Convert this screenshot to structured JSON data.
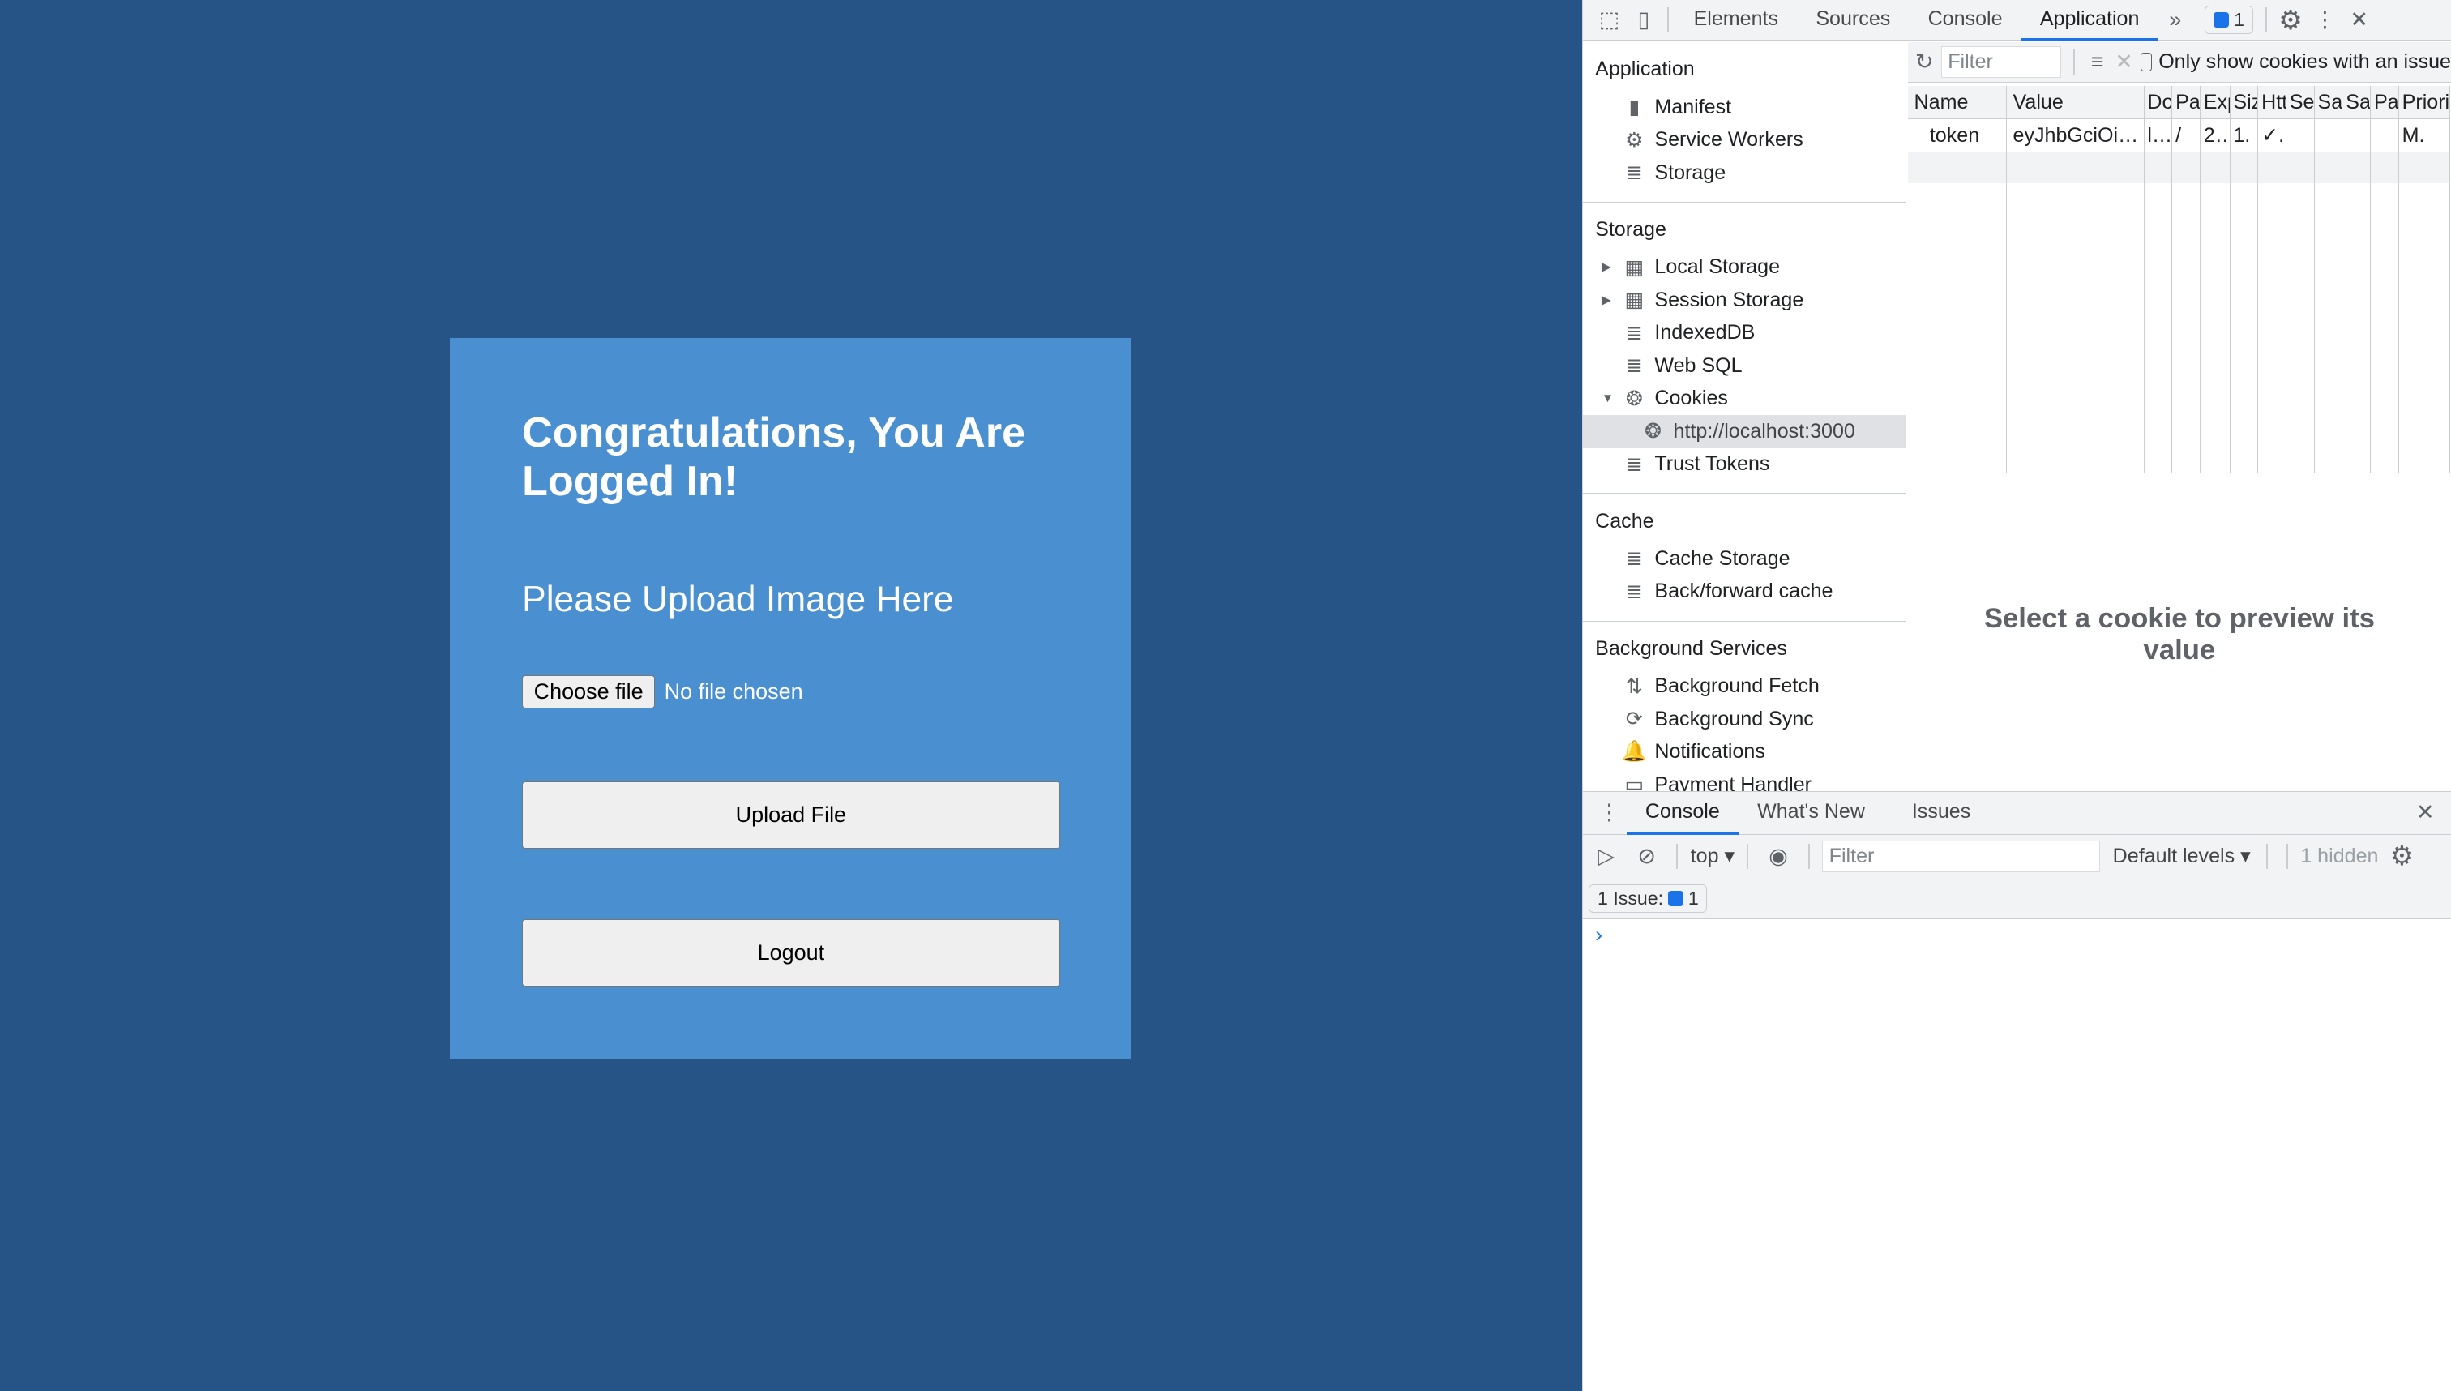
{
  "page": {
    "heading": "Congratulations, You Are Logged In!",
    "subheading": "Please Upload Image Here",
    "choose_file": "Choose file",
    "no_file": "No file chosen",
    "upload": "Upload File",
    "logout": "Logout",
    "colors": {
      "background": "#265486",
      "card": "#4a90d0"
    }
  },
  "devtools": {
    "tabs": [
      "Elements",
      "Sources",
      "Console",
      "Application"
    ],
    "active_tab": "Application",
    "more": "»",
    "issues_count": "1",
    "sidebar": [
      {
        "title": "Application",
        "items": [
          {
            "label": "Manifest",
            "icon": "file-icon"
          },
          {
            "label": "Service Workers",
            "icon": "gear-icon"
          },
          {
            "label": "Storage",
            "icon": "database-icon"
          }
        ]
      },
      {
        "title": "Storage",
        "items": [
          {
            "label": "Local Storage",
            "icon": "grid-icon",
            "arrow": "▶"
          },
          {
            "label": "Session Storage",
            "icon": "grid-icon",
            "arrow": "▶"
          },
          {
            "label": "IndexedDB",
            "icon": "database-icon"
          },
          {
            "label": "Web SQL",
            "icon": "database-icon"
          },
          {
            "label": "Cookies",
            "icon": "cookie-icon",
            "arrow": "▼"
          },
          {
            "label": "http://localhost:3000",
            "icon": "cookie-icon",
            "child": true,
            "selected": true
          },
          {
            "label": "Trust Tokens",
            "icon": "database-icon"
          }
        ]
      },
      {
        "title": "Cache",
        "items": [
          {
            "label": "Cache Storage",
            "icon": "database-icon"
          },
          {
            "label": "Back/forward cache",
            "icon": "database-icon"
          }
        ]
      },
      {
        "title": "Background Services",
        "items": [
          {
            "label": "Background Fetch",
            "icon": "arrows-icon"
          },
          {
            "label": "Background Sync",
            "icon": "sync-icon"
          },
          {
            "label": "Notifications",
            "icon": "bell-icon"
          },
          {
            "label": "Payment Handler",
            "icon": "card-icon"
          }
        ]
      }
    ],
    "cookies": {
      "filter_placeholder": "Filter",
      "only_show": "Only show cookies with an issue",
      "columns": [
        "Name",
        "Value",
        "Domain",
        "Path",
        "Expires / Max-Age",
        "Size",
        "HttpOnly",
        "Secure",
        "SameSite",
        "SameParty",
        "Partition Key",
        "Priority"
      ],
      "rows": [
        [
          "token",
          "eyJhbGciOi…",
          "l…",
          "/",
          "2…",
          "1.",
          "✓.",
          "",
          "",
          "",
          "",
          "M."
        ]
      ],
      "preview": "Select a cookie to preview its value"
    },
    "drawer": {
      "tabs": [
        "Console",
        "What's New",
        "Issues"
      ],
      "active": "Console",
      "context": "top",
      "filter_placeholder": "Filter",
      "levels": "Default levels",
      "hidden": "1 hidden",
      "issues_label": "1 Issue:",
      "issues_count": "1",
      "prompt": "›"
    }
  }
}
